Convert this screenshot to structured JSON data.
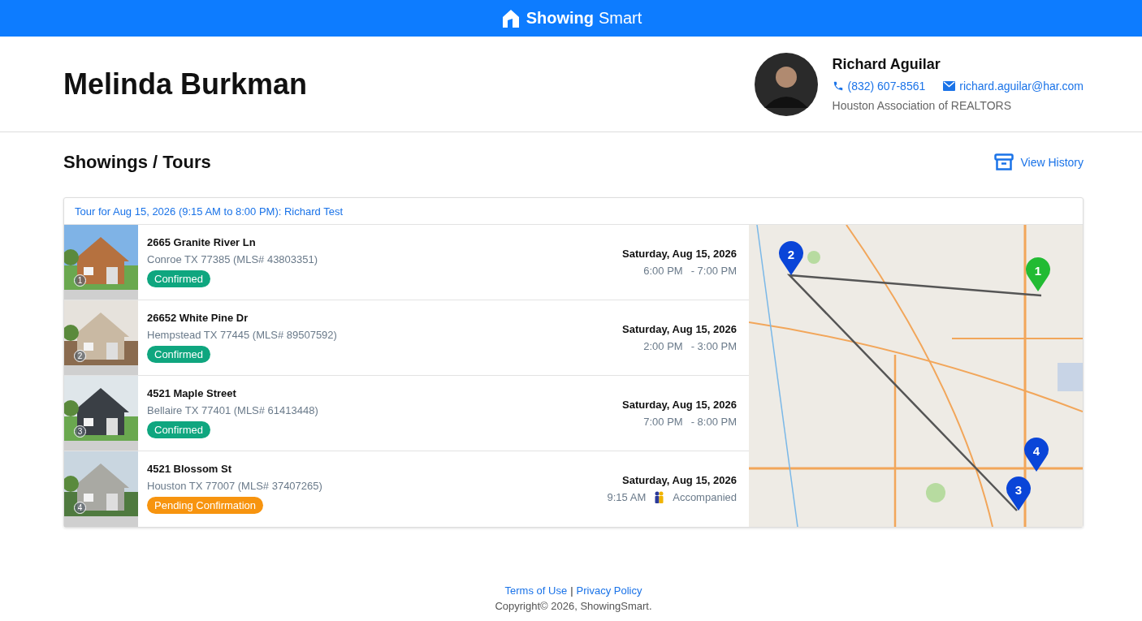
{
  "brand": {
    "word_1": "Showing",
    "word_2": "Smart"
  },
  "client": {
    "name": "Melinda Burkman"
  },
  "agent": {
    "name": "Richard Aguilar",
    "phone": "(832) 607-8561",
    "email": "richard.aguilar@har.com",
    "organization": "Houston Association of REALTORS"
  },
  "section": {
    "title": "Showings / Tours",
    "history_link": "View History"
  },
  "tour": {
    "title": "Tour for Aug 15, 2026 (9:15 AM to 8:00 PM): Richard Test",
    "showings": [
      {
        "number": "1",
        "address": "2665 Granite River Ln",
        "locality": "Conroe TX 77385 (MLS# 43803351)",
        "status": "Confirmed",
        "kind": "confirmed",
        "date": "Saturday, Aug 15, 2026",
        "start": "6:00 PM",
        "end": "- 7:00 PM"
      },
      {
        "number": "2",
        "address": "26652 White Pine Dr",
        "locality": "Hempstead TX 77445 (MLS# 89507592)",
        "status": "Confirmed",
        "kind": "confirmed",
        "date": "Saturday, Aug 15, 2026",
        "start": "2:00 PM",
        "end": "- 3:00 PM"
      },
      {
        "number": "3",
        "address": "4521 Maple Street",
        "locality": "Bellaire TX 77401 (MLS# 61413448)",
        "status": "Confirmed",
        "kind": "confirmed",
        "date": "Saturday, Aug 15, 2026",
        "start": "7:00 PM",
        "end": "- 8:00 PM"
      },
      {
        "number": "4",
        "address": "4521 Blossom St",
        "locality": "Houston TX 77007 (MLS# 37407265)",
        "status": "Pending Confirmation",
        "kind": "pending",
        "date": "Saturday, Aug 15, 2026",
        "start": "9:15 AM",
        "accompaniment": "Accompanied"
      }
    ],
    "map_pins": [
      {
        "label": "1",
        "color": "#22bb33"
      },
      {
        "label": "2",
        "color": "#0a45d8"
      },
      {
        "label": "3",
        "color": "#0a45d8"
      },
      {
        "label": "4",
        "color": "#0a45d8"
      }
    ]
  },
  "footer": {
    "terms": "Terms of Use",
    "separator": "|",
    "privacy": "Privacy Policy",
    "copyright": "Copyright© 2026, ShowingSmart."
  }
}
